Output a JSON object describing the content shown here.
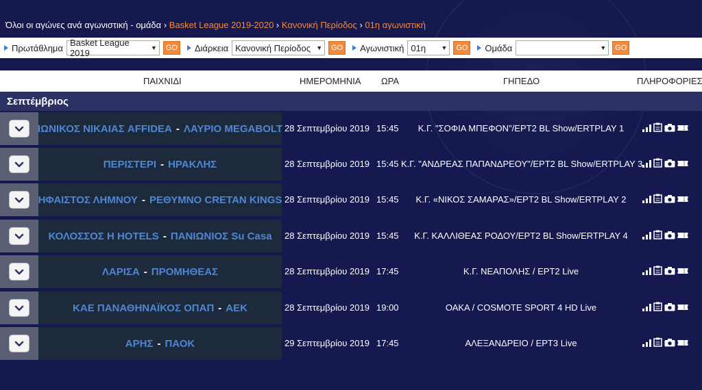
{
  "breadcrumb": {
    "root": "Όλοι οι αγώνες ανά αγωνιστική - ομάδα",
    "sep": "›",
    "league": "Basket League 2019-2020",
    "period": "Κανονική Περίοδος",
    "round": "01η αγωνιστική"
  },
  "filters": {
    "championship_label": "Πρωτάθλημα",
    "championship_value": "Basket League 2019",
    "duration_label": "Διάρκεια",
    "duration_value": "Κανονική Περίοδος",
    "round_label": "Αγωνιστική",
    "round_value": "01η",
    "team_label": "Ομάδα",
    "team_value": "",
    "go_label": "GO"
  },
  "columns": {
    "game": "ΠΑΙΧΝΙΔΙ",
    "date": "ΗΜΕΡΟΜΗΝΙΑ",
    "time": "ΩΡΑ",
    "venue": "ΓΗΠΕΔΟ",
    "info": "ΠΛΗΡΟΦΟΡΙΕΣ"
  },
  "month": "Σεπτέμβριος",
  "games": [
    {
      "home": "ΙΩΝΙΚΟΣ ΝΙΚΑΙΑΣ AFFIDEA",
      "away": "ΛΑΥΡΙΟ MEGABOLT",
      "date": "28 Σεπτεμβρίου 2019",
      "time": "15:45",
      "venue": "Κ.Γ. \"ΣΟΦΙΑ ΜΠΕΦΟΝ\"/ΕΡΤ2 BL Show/ERTPLAY 1"
    },
    {
      "home": "ΠΕΡΙΣΤΕΡΙ",
      "away": "ΗΡΑΚΛΗΣ",
      "date": "28 Σεπτεμβρίου 2019",
      "time": "15:45",
      "venue": "Κ.Γ. \"ΑΝΔΡΕΑΣ ΠΑΠΑΝΔΡΕΟΥ\"/ΕΡΤ2 BL Show/ERTPLAY 3"
    },
    {
      "home": "ΗΦΑΙΣΤΟΣ ΛΗΜΝΟΥ",
      "away": "ΡΕΘΥΜΝΟ CRETAN KINGS",
      "date": "28 Σεπτεμβρίου 2019",
      "time": "15:45",
      "venue": "Κ.Γ. «ΝΙΚΟΣ ΣΑΜΑΡΑΣ»/ΕΡΤ2 BL Show/ERTPLAY 2"
    },
    {
      "home": "ΚΟΛΟΣΣΟΣ Η HOTELS",
      "away": "ΠΑΝΙΩΝΙΟΣ Su Casa",
      "date": "28 Σεπτεμβρίου 2019",
      "time": "15:45",
      "venue": "Κ.Γ. ΚΑΛΛΙΘΕΑΣ ΡΟΔΟΥ/ΕΡΤ2 BL Show/ERTPLAY 4"
    },
    {
      "home": "ΛΑΡΙΣΑ",
      "away": "ΠΡΟΜΗΘΕΑΣ",
      "date": "28 Σεπτεμβρίου 2019",
      "time": "17:45",
      "venue": "Κ.Γ. ΝΕΑΠΟΛΗΣ / ΕΡΤ2 Live"
    },
    {
      "home": "ΚΑΕ ΠΑΝΑΘΗΝΑΪΚΟΣ ΟΠΑΠ",
      "away": "ΑΕΚ",
      "date": "28 Σεπτεμβρίου 2019",
      "time": "19:00",
      "venue": "ΟΑΚΑ / COSMOTE SPORT 4 HD Live"
    },
    {
      "home": "ΑΡΗΣ",
      "away": "ΠΑΟΚ",
      "date": "29 Σεπτεμβρίου 2019",
      "time": "17:45",
      "venue": "ΑΛΕΞΑΝΔΡΕΙΟ / ΕΡΤ3 Live"
    }
  ],
  "info_icons": [
    "stats-icon",
    "boxscore-icon",
    "camera-icon",
    "ticket-icon"
  ],
  "colors": {
    "background": "#15194f",
    "accent": "#f28a3c",
    "team_link": "#4f86d3"
  }
}
